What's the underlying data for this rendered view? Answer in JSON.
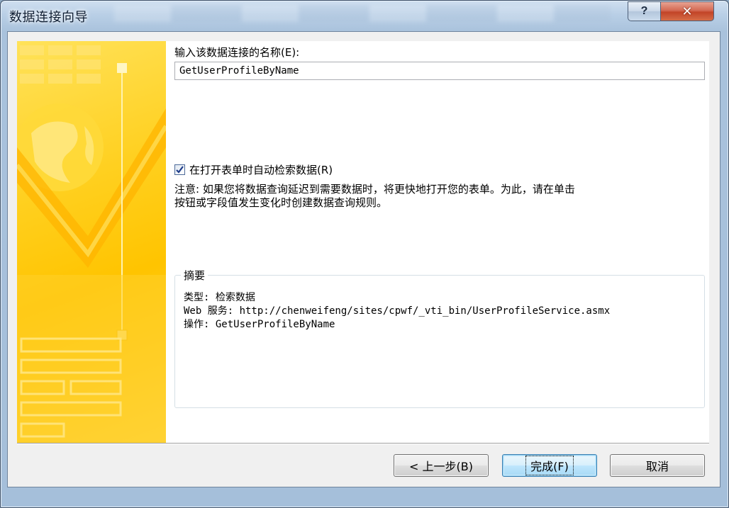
{
  "window": {
    "title": "数据连接向导",
    "help_glyph": "?",
    "close_glyph": "✕"
  },
  "form": {
    "name_label": "输入该数据连接的名称(E):",
    "name_value": "GetUserProfileByName",
    "auto_retrieve_checked": true,
    "auto_retrieve_label": "在打开表单时自动检索数据(R)",
    "note_line1": "注意: 如果您将数据查询延迟到需要数据时，将更快地打开您的表单。为此，请在单击",
    "note_line2": "按钮或字段值发生变化时创建数据查询规则。"
  },
  "summary": {
    "title": "摘要",
    "type_line": "类型: 检索数据",
    "service_line": "Web 服务: http://chenweifeng/sites/cpwf/_vti_bin/UserProfileService.asmx",
    "operation_line": "操作: GetUserProfileByName"
  },
  "buttons": {
    "back": "< 上一步(B)",
    "finish": "完成(F)",
    "cancel": "取消"
  },
  "colors": {
    "banner_yellow": "#ffc400",
    "close_red": "#c24428",
    "checkbox_check": "#1f3d8a"
  }
}
